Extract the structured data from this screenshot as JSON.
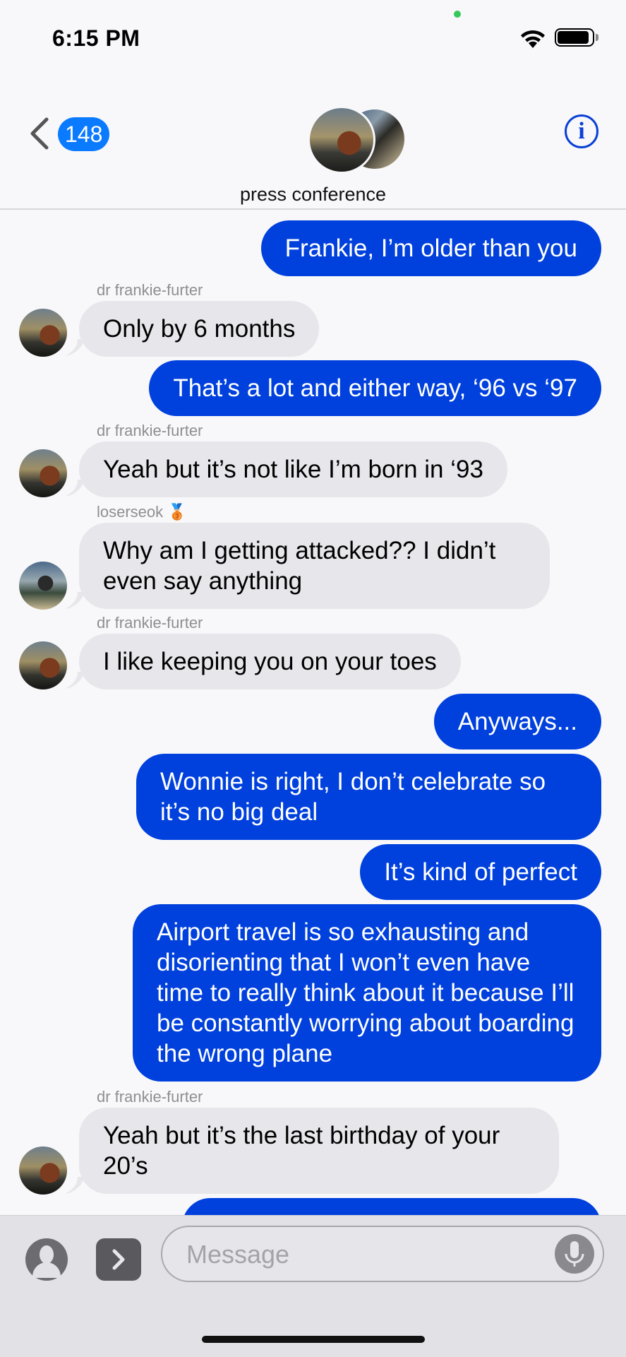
{
  "status_bar": {
    "time": "6:15 PM"
  },
  "header": {
    "back_count": "148",
    "title": "press conference"
  },
  "messages": [
    {
      "dir": "out",
      "text": "Frankie, I’m older than you"
    },
    {
      "dir": "in",
      "sender": "dr frankie-furter",
      "text": "Only by 6 months"
    },
    {
      "dir": "out",
      "text": "That’s a lot and either way, ‘96 vs ‘97"
    },
    {
      "dir": "in",
      "sender": "dr frankie-furter",
      "text": "Yeah but it’s not like I’m born in ‘93"
    },
    {
      "dir": "in",
      "sender": "loserseok",
      "sender_emoji": "🥉",
      "text": "Why am I getting attacked?? I didn’t even say anything"
    },
    {
      "dir": "in",
      "sender": "dr frankie-furter",
      "text": "I like keeping you on your toes"
    },
    {
      "dir": "out",
      "text": "Anyways..."
    },
    {
      "dir": "out",
      "text": "Wonnie is right, I don’t celebrate so it’s no big deal"
    },
    {
      "dir": "out",
      "text": "It’s kind of perfect"
    },
    {
      "dir": "out",
      "text": "Airport travel is so exhausting and disorienting that I won’t even have time to really think about it because I’ll be constantly worrying about boarding the wrong plane"
    },
    {
      "dir": "in",
      "sender": "dr frankie-furter",
      "text": "Yeah but it’s the last birthday of your 20’s"
    }
  ],
  "input": {
    "placeholder": "Message"
  },
  "colors": {
    "outgoing": "#0040dd",
    "incoming": "#e6e6eb",
    "badge": "#0a7aff",
    "info": "#0a40d6"
  },
  "icons": [
    "back-chevron-icon",
    "info-icon",
    "contact-icon",
    "apps-icon",
    "microphone-icon",
    "wifi-icon",
    "battery-icon"
  ]
}
